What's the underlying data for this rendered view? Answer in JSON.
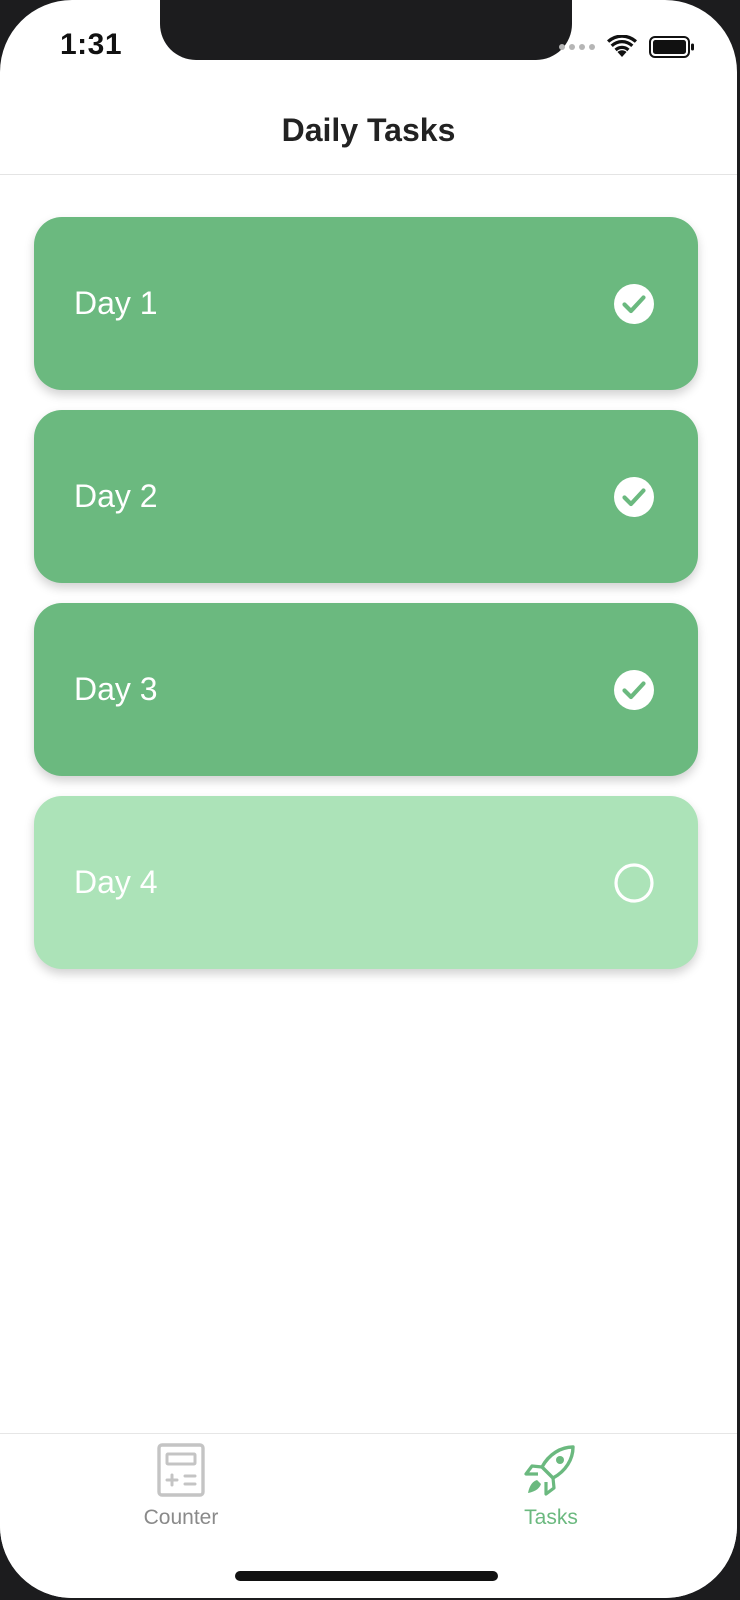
{
  "status_bar": {
    "time": "1:31"
  },
  "header": {
    "title": "Daily Tasks"
  },
  "tasks": [
    {
      "label": "Day 1",
      "completed": true,
      "icon": "check-circle-icon"
    },
    {
      "label": "Day 2",
      "completed": true,
      "icon": "check-circle-icon"
    },
    {
      "label": "Day 3",
      "completed": true,
      "icon": "check-circle-icon"
    },
    {
      "label": "Day 4",
      "completed": false,
      "icon": "empty-circle-icon"
    }
  ],
  "tab_bar": {
    "tabs": [
      {
        "label": "Counter",
        "icon": "calculator-icon",
        "active": false
      },
      {
        "label": "Tasks",
        "icon": "rocket-icon",
        "active": true
      }
    ]
  },
  "colors": {
    "task_completed": "#6bb97f",
    "task_pending": "#ace3b8",
    "active_tab": "#6bb97f",
    "inactive_tab": "#8a8a8a"
  }
}
